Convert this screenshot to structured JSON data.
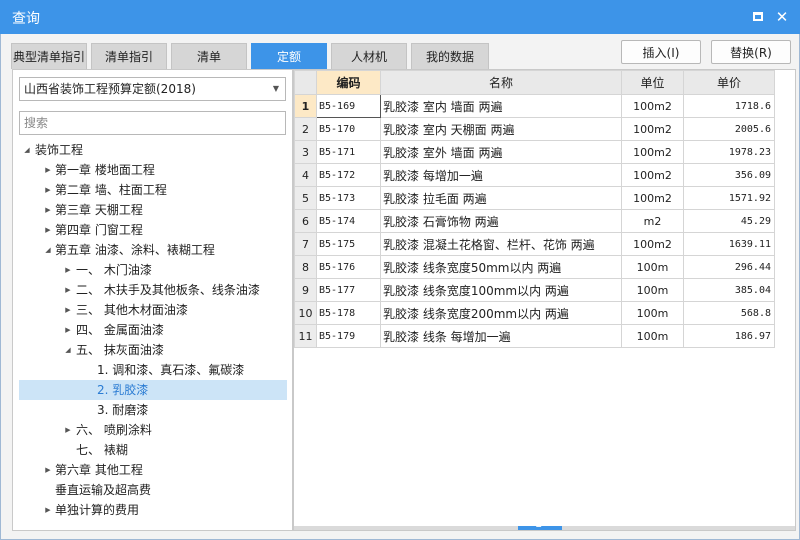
{
  "window": {
    "title": "查询"
  },
  "tabs": [
    "典型清单指引",
    "清单指引",
    "清单",
    "定额",
    "人材机",
    "我的数据"
  ],
  "active_tab": 3,
  "actions": {
    "insert": "插入(I)",
    "replace": "替换(R)"
  },
  "quota_select": {
    "value": "山西省装饰工程预算定额(2018)"
  },
  "search": {
    "placeholder": "搜索",
    "value": ""
  },
  "tree": [
    {
      "label": "装饰工程",
      "toggle": "expanded"
    },
    {
      "label": "第一章 楼地面工程",
      "toggle": "collapsed"
    },
    {
      "label": "第二章 墙、柱面工程",
      "toggle": "collapsed"
    },
    {
      "label": "第三章 天棚工程",
      "toggle": "collapsed"
    },
    {
      "label": "第四章 门窗工程",
      "toggle": "collapsed"
    },
    {
      "label": "第五章 油漆、涂料、裱糊工程",
      "toggle": "expanded"
    },
    {
      "label": "一、 木门油漆",
      "toggle": "collapsed"
    },
    {
      "label": "二、 木扶手及其他板条、线条油漆",
      "toggle": "collapsed"
    },
    {
      "label": "三、 其他木材面油漆",
      "toggle": "collapsed"
    },
    {
      "label": "四、 金属面油漆",
      "toggle": "collapsed"
    },
    {
      "label": "五、 抹灰面油漆",
      "toggle": "expanded"
    },
    {
      "label": "1. 调和漆、真石漆、氟碳漆",
      "toggle": "none"
    },
    {
      "label": "2. 乳胶漆",
      "toggle": "none"
    },
    {
      "label": "3. 耐磨漆",
      "toggle": "none"
    },
    {
      "label": "六、 喷刷涂料",
      "toggle": "collapsed"
    },
    {
      "label": "七、 裱糊",
      "toggle": "none"
    },
    {
      "label": "第六章 其他工程",
      "toggle": "collapsed"
    },
    {
      "label": "垂直运输及超高费",
      "toggle": "none"
    },
    {
      "label": "单独计算的费用",
      "toggle": "collapsed"
    }
  ],
  "selected_tree_index": 12,
  "icons": {
    "expanded": "triangle-down-icon",
    "collapsed": "triangle-right-icon",
    "dropdown": "chevron-down-icon"
  },
  "colors": {
    "accent": "#3d94e8",
    "selected_bg": "#cce4f7",
    "code_header_bg": "#fde9c6"
  },
  "grid": {
    "columns": [
      "编码",
      "名称",
      "单位",
      "单价"
    ],
    "selected_row": 0,
    "rows": [
      {
        "n": "1",
        "code": "B5-169",
        "name": "乳胶漆 室内 墙面 两遍",
        "unit": "100m2",
        "price": "1718.6"
      },
      {
        "n": "2",
        "code": "B5-170",
        "name": "乳胶漆 室内 天棚面 两遍",
        "unit": "100m2",
        "price": "2005.6"
      },
      {
        "n": "3",
        "code": "B5-171",
        "name": "乳胶漆 室外 墙面 两遍",
        "unit": "100m2",
        "price": "1978.23"
      },
      {
        "n": "4",
        "code": "B5-172",
        "name": "乳胶漆 每增加一遍",
        "unit": "100m2",
        "price": "356.09"
      },
      {
        "n": "5",
        "code": "B5-173",
        "name": "乳胶漆 拉毛面 两遍",
        "unit": "100m2",
        "price": "1571.92"
      },
      {
        "n": "6",
        "code": "B5-174",
        "name": "乳胶漆 石膏饰物 两遍",
        "unit": "m2",
        "price": "45.29"
      },
      {
        "n": "7",
        "code": "B5-175",
        "name": "乳胶漆 混凝土花格窗、栏杆、花饰 两遍",
        "unit": "100m2",
        "price": "1639.11"
      },
      {
        "n": "8",
        "code": "B5-176",
        "name": "乳胶漆 线条宽度50mm以内 两遍",
        "unit": "100m",
        "price": "296.44"
      },
      {
        "n": "9",
        "code": "B5-177",
        "name": "乳胶漆 线条宽度100mm以内 两遍",
        "unit": "100m",
        "price": "385.04"
      },
      {
        "n": "10",
        "code": "B5-178",
        "name": "乳胶漆 线条宽度200mm以内 两遍",
        "unit": "100m",
        "price": "568.8"
      },
      {
        "n": "11",
        "code": "B5-179",
        "name": "乳胶漆 线条 每增加一遍",
        "unit": "100m",
        "price": "186.97"
      }
    ]
  }
}
